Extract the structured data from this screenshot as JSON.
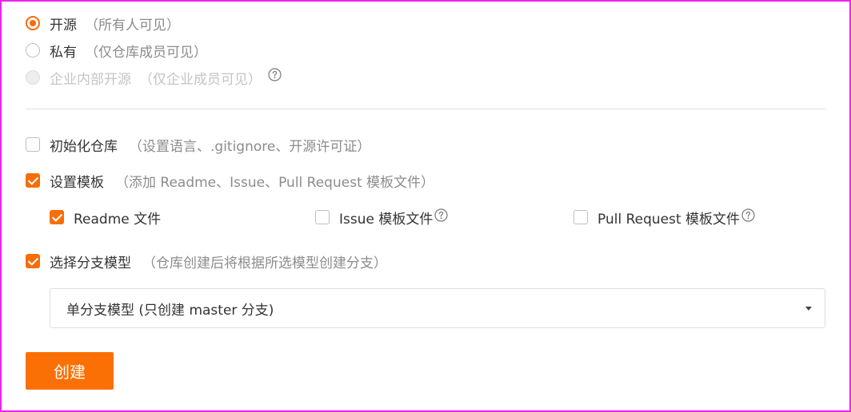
{
  "visibility": {
    "options": [
      {
        "label": "开源",
        "hint": "（所有人可见）",
        "checked": true
      },
      {
        "label": "私有",
        "hint": "（仅仓库成员可见）",
        "checked": false
      },
      {
        "label": "企业内部开源",
        "hint": "（仅企业成员可见）",
        "checked": false,
        "disabled": true
      }
    ]
  },
  "init_repo": {
    "label": "初始化仓库",
    "hint": "（设置语言、.gitignore、开源许可证）",
    "checked": false
  },
  "templates": {
    "label": "设置模板",
    "hint": "（添加 Readme、Issue、Pull Request 模板文件）",
    "checked": true,
    "items": [
      {
        "label": "Readme 文件",
        "checked": true
      },
      {
        "label": "Issue 模板文件",
        "checked": false
      },
      {
        "label": "Pull Request 模板文件",
        "checked": false
      }
    ]
  },
  "branch_model": {
    "label": "选择分支模型",
    "hint": "（仓库创建后将根据所选模型创建分支）",
    "checked": true,
    "selected": "单分支模型 (只创建 master 分支)"
  },
  "actions": {
    "create_label": "创建"
  },
  "colors": {
    "accent": "#f86d08",
    "button": "#fb7004",
    "frame": "#ee22ee"
  }
}
